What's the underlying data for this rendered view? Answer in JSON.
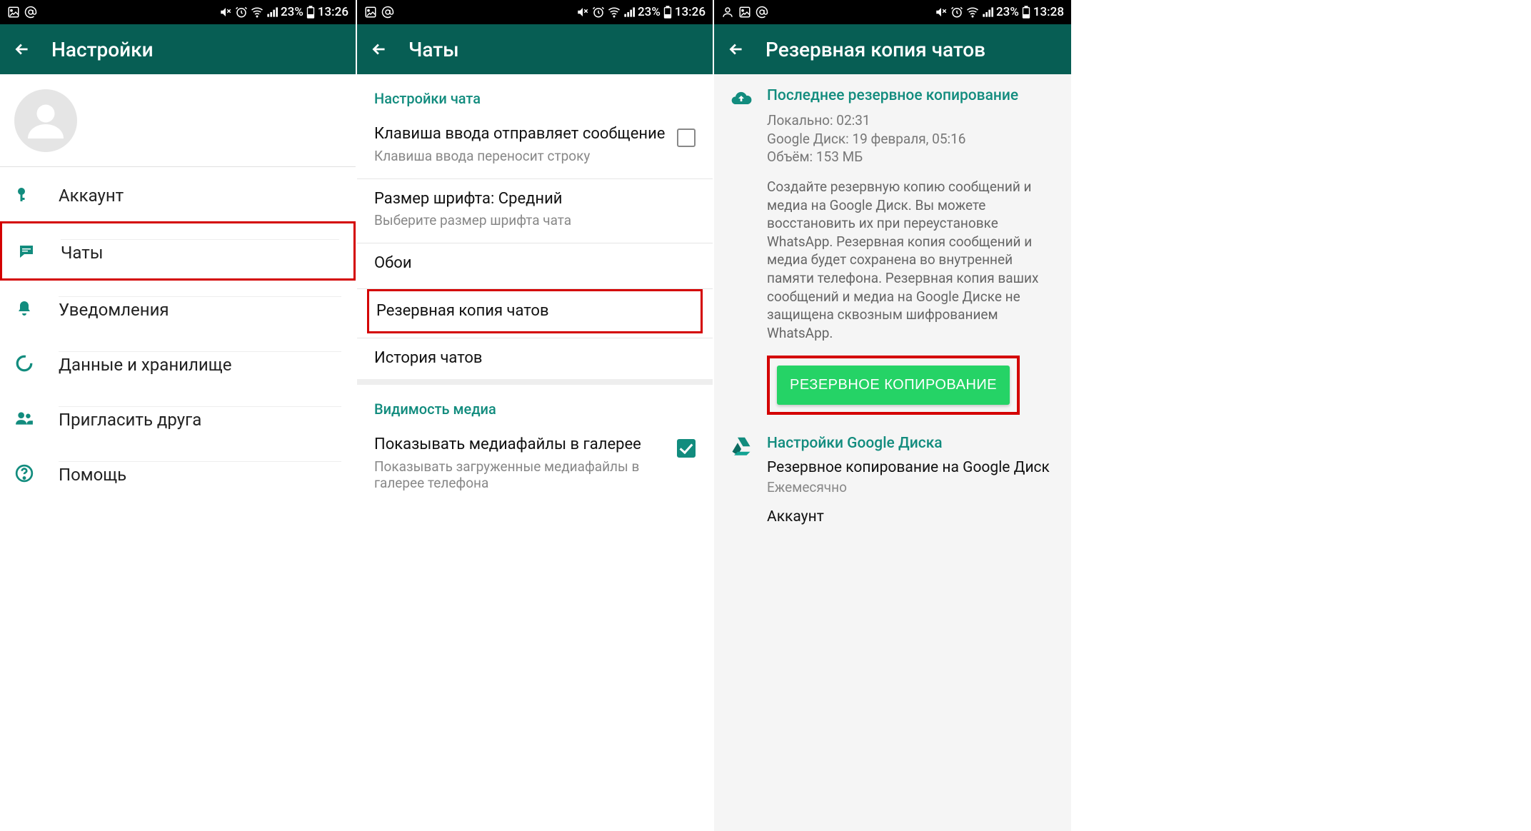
{
  "status": {
    "battery_pct": "23%",
    "time_a": "13:26",
    "time_b": "13:28"
  },
  "screen1": {
    "title": "Настройки",
    "items": {
      "account": "Аккаунт",
      "chats": "Чаты",
      "notifications": "Уведомления",
      "data": "Данные и хранилище",
      "invite": "Пригласить друга",
      "help": "Помощь"
    }
  },
  "screen2": {
    "title": "Чаты",
    "section_chat_settings": "Настройки чата",
    "enter_key_title": "Клавиша ввода отправляет сообщение",
    "enter_key_sub": "Клавиша ввода переносит строку",
    "font_size_title": "Размер шрифта: Средний",
    "font_size_sub": "Выберите размер шрифта чата",
    "wallpaper": "Обои",
    "backup": "Резервная копия чатов",
    "history": "История чатов",
    "section_media": "Видимость медиа",
    "media_title": "Показывать медиафайлы в галерее",
    "media_sub": "Показывать загруженные медиафайлы в галерее телефона"
  },
  "screen3": {
    "title": "Резервная копия чатов",
    "last_backup_header": "Последнее резервное копирование",
    "local_line": "Локально: 02:31",
    "gdrive_line": "Google Диск: 19 февраля, 05:16",
    "size_line": "Объём: 153 МБ",
    "paragraph": "Создайте резервную копию сообщений и медиа на Google Диск. Вы можете восстановить их при переустановке WhatsApp. Резервная копия сообщений и медиа будет сохранена во внутренней памяти телефона. Резервная копия ваших сообщений и медиа на Google Диске не защищена сквозным шифрованием WhatsApp.",
    "button": "РЕЗЕРВНОЕ КОПИРОВАНИЕ",
    "gdrive_settings_header": "Настройки Google Диска",
    "gdrive_backup_title": "Резервное копирование на Google Диск",
    "gdrive_backup_freq": "Ежемесячно",
    "account_label": "Аккаунт"
  }
}
